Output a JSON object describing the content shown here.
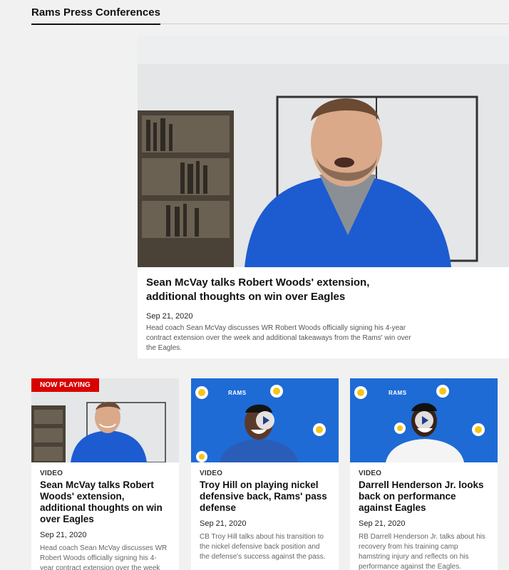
{
  "section": {
    "title": "Rams Press Conferences"
  },
  "featured": {
    "headline": "Sean McVay talks Robert Woods' extension, additional thoughts on win over Eagles",
    "date": "Sep 21, 2020",
    "description": "Head coach Sean McVay discusses WR Robert Woods officially signing his 4-year contract extension over the week and additional takeaways from the Rams' win over the Eagles."
  },
  "cards": [
    {
      "badge": "NOW PLAYING",
      "kind": "VIDEO",
      "title": "Sean McVay talks Robert Woods' extension, additional thoughts on win over Eagles",
      "date": "Sep 21, 2020",
      "description": "Head coach Sean McVay discusses WR Robert Woods officially signing his 4-year contract extension over the week and"
    },
    {
      "kind": "VIDEO",
      "title": "Troy Hill on playing nickel defensive back, Rams' pass defense",
      "date": "Sep 21, 2020",
      "description": "CB Troy Hill talks about his transition to the nickel defensive back position and the defense's success against the pass.",
      "backdrop_text": "RAMS"
    },
    {
      "kind": "VIDEO",
      "title": "Darrell Henderson Jr. looks back on performance against Eagles",
      "date": "Sep 21, 2020",
      "description": "RB Darrell Henderson Jr. talks about his recovery from his training camp hamstring injury and reflects on his performance against the Eagles.",
      "backdrop_text": "RAMS"
    }
  ],
  "colors": {
    "rams_blue": "#1e6bd6",
    "now_playing_red": "#d90000"
  }
}
